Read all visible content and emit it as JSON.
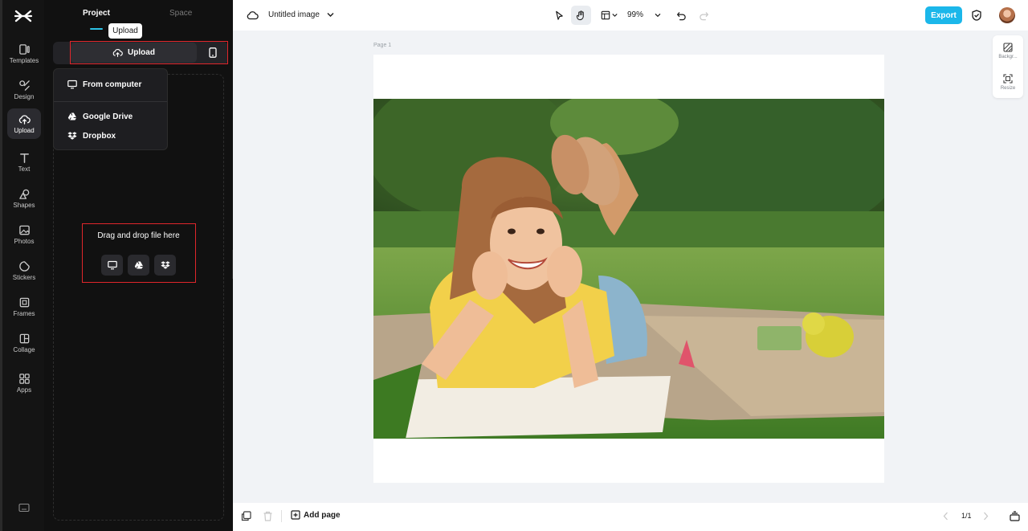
{
  "rail": {
    "items": [
      {
        "label": "Templates",
        "icon": "templates-icon"
      },
      {
        "label": "Design",
        "icon": "design-icon"
      },
      {
        "label": "Upload",
        "icon": "upload-cloud-icon",
        "active": true
      },
      {
        "label": "Text",
        "icon": "text-icon"
      },
      {
        "label": "Shapes",
        "icon": "shapes-icon"
      },
      {
        "label": "Photos",
        "icon": "photos-icon"
      },
      {
        "label": "Stickers",
        "icon": "stickers-icon"
      },
      {
        "label": "Frames",
        "icon": "frames-icon"
      },
      {
        "label": "Collage",
        "icon": "collage-icon"
      },
      {
        "label": "Apps",
        "icon": "apps-icon"
      }
    ]
  },
  "panel": {
    "tabs": [
      {
        "label": "Project",
        "active": true
      },
      {
        "label": "Space",
        "active": false
      }
    ],
    "tooltip": "Upload",
    "upload_button": "Upload",
    "menu": {
      "items": [
        {
          "label": "From computer",
          "icon": "monitor-icon"
        },
        {
          "label": "Google Drive",
          "icon": "google-drive-icon"
        },
        {
          "label": "Dropbox",
          "icon": "dropbox-icon"
        }
      ]
    },
    "dropzone": {
      "title": "Drag and drop file here"
    }
  },
  "topbar": {
    "title": "Untitled image",
    "zoom": "99%",
    "export_label": "Export"
  },
  "canvas": {
    "page_label": "Page 1",
    "right_tools": [
      {
        "label": "Backgr...",
        "icon": "background-icon"
      },
      {
        "label": "Resize",
        "icon": "resize-icon"
      }
    ]
  },
  "bottombar": {
    "add_page_label": "Add page",
    "page_count": "1/1"
  },
  "colors": {
    "accent": "#1bb7ea",
    "highlight_box": "#e0262b",
    "sidebar_bg": "#111111"
  }
}
